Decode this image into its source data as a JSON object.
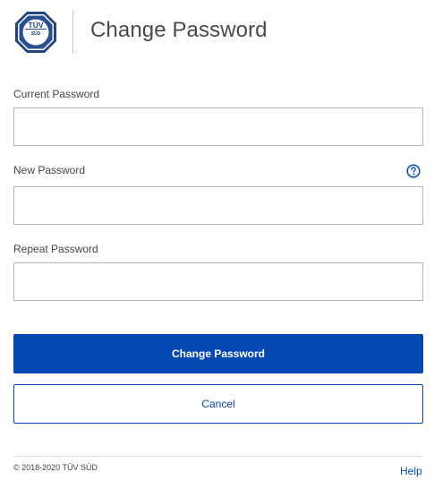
{
  "header": {
    "logo_text_top": "TÜV",
    "logo_text_bottom": "SÜD",
    "title": "Change Password"
  },
  "form": {
    "current_password": {
      "label": "Current Password",
      "value": "",
      "placeholder": ""
    },
    "new_password": {
      "label": "New Password",
      "value": "",
      "placeholder": "",
      "help_icon": "question-circle-icon"
    },
    "repeat_password": {
      "label": "Repeat Password",
      "value": "",
      "placeholder": ""
    },
    "submit_label": "Change Password",
    "cancel_label": "Cancel"
  },
  "footer": {
    "copyright": "© 2018-2020 TÜV SÜD",
    "help_label": "Help"
  },
  "colors": {
    "primary": "#0648b2",
    "logo_navy": "#1f3f7a",
    "border": "#b5b5b5",
    "text": "#444444"
  }
}
